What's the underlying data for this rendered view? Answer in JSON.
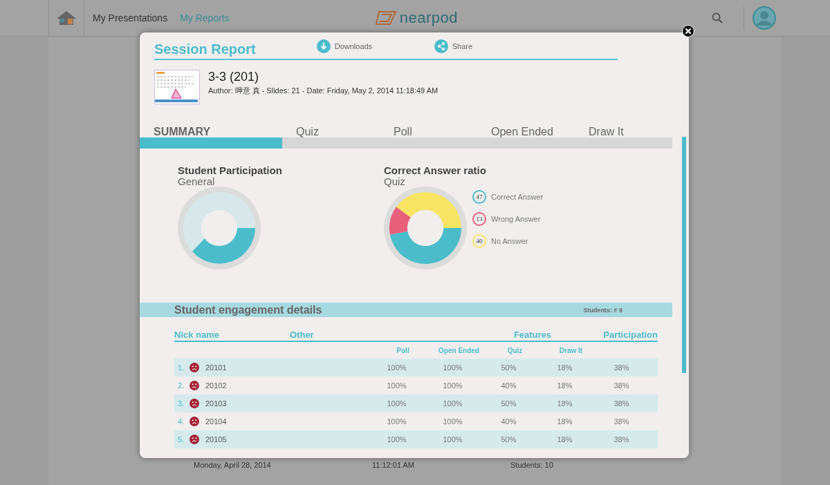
{
  "topbar": {
    "nav": [
      {
        "label": "My Presentations",
        "selected": false
      },
      {
        "label": "My Reports",
        "selected": true
      }
    ],
    "logo": "nearpod"
  },
  "background_row": [
    "Monday, April 28, 2014",
    "11:12:01 AM",
    "Students: 10"
  ],
  "report": {
    "title": "Session Report",
    "actions": [
      "Downloads",
      "Share"
    ],
    "presentation": {
      "name": "3-3 (201)",
      "meta": "Author: 呷意 真 - Slides: 21 - Date: Friday, May 2, 2014 11:18:49 AM"
    },
    "tabs": [
      {
        "label": "SUMMARY",
        "selected": true
      },
      {
        "label": "Quiz",
        "selected": false
      },
      {
        "label": "Poll",
        "selected": false
      },
      {
        "label": "Open Ended",
        "selected": false
      },
      {
        "label": "Draw It",
        "selected": false
      }
    ],
    "participation": {
      "title": "Student Participation",
      "subtitle": "General"
    },
    "answers": {
      "title": "Correct Answer ratio",
      "chart_data": {
        "type": "donut",
        "categories": [
          "Correct Answer",
          "Wrong Answer",
          "No Answer"
        ],
        "series": [
          {
            "name": "Quiz",
            "values": [
              47,
              13,
              40
            ]
          }
        ]
      },
      "legend": [
        {
          "value": "47",
          "color": "#4bbcca"
        },
        {
          "value": "13",
          "color": "#e9607c"
        },
        {
          "value": "40",
          "color": "#f7e463"
        }
      ]
    },
    "engagement": {
      "title": "Student engagement details",
      "students": "Students: # 9",
      "group_headers": [
        "Nick name",
        "Other",
        "Features",
        "Participation"
      ],
      "feature_columns": [
        "Poll",
        "Open Ended",
        "Quiz",
        "Draw It"
      ],
      "rows": [
        {
          "num": "1.",
          "name": "20101",
          "values": [
            "100%",
            "100%",
            "50%",
            "18%"
          ],
          "participation": "38%"
        },
        {
          "num": "2.",
          "name": "20102",
          "values": [
            "100%",
            "100%",
            "40%",
            "18%"
          ],
          "participation": "38%"
        },
        {
          "num": "3.",
          "name": "20103",
          "values": [
            "100%",
            "100%",
            "50%",
            "18%"
          ],
          "participation": "38%"
        },
        {
          "num": "4.",
          "name": "20104",
          "values": [
            "100%",
            "100%",
            "40%",
            "18%"
          ],
          "participation": "38%"
        },
        {
          "num": "5.",
          "name": "20105",
          "values": [
            "100%",
            "100%",
            "50%",
            "18%"
          ],
          "participation": "38%"
        }
      ]
    }
  }
}
